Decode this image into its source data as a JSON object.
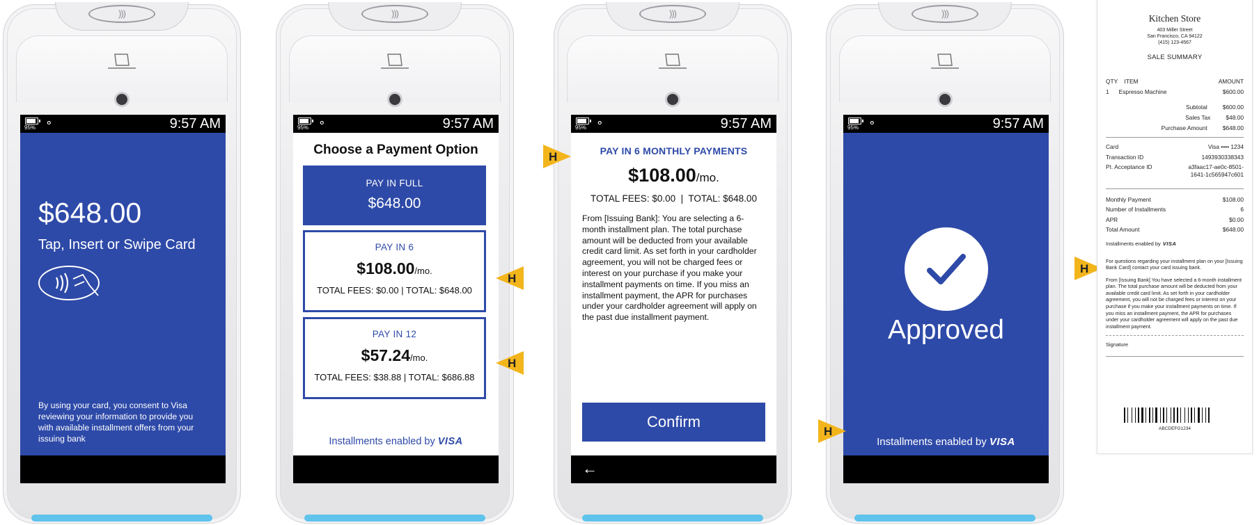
{
  "status_bar": {
    "battery_pct": "95%",
    "time": "9:57 AM"
  },
  "screen1": {
    "amount": "$648.00",
    "instruction": "Tap, Insert or Swipe Card",
    "consent": "By using your card, you consent to Visa reviewing your information to provide you with available installment offers from your issuing bank"
  },
  "screen2": {
    "title": "Choose a Payment Option",
    "options": [
      {
        "label": "PAY IN FULL",
        "amount": "$648.00"
      },
      {
        "label": "PAY IN 6",
        "amount": "$108.00",
        "unit": "/mo.",
        "fees": "TOTAL FEES: $0.00",
        "total": "TOTAL: $648.00"
      },
      {
        "label": "PAY IN 12",
        "amount": "$57.24",
        "unit": "/mo.",
        "fees": "TOTAL FEES: $38.88",
        "total": "TOTAL: $686.88"
      }
    ],
    "enabled_text": "Installments enabled by",
    "enabled_brand": "VISA"
  },
  "screen3": {
    "heading": "PAY IN 6 MONTHLY PAYMENTS",
    "amount": "$108.00",
    "unit": "/mo.",
    "fees": "TOTAL FEES: $0.00",
    "total": "TOTAL: $648.00",
    "disclosure": "From [Issuing Bank]: You are selecting a 6-month installment plan. The total purchase amount will be deducted from your available credit card limit. As set forth in your cardholder agreement, you will not be charged fees or interest on your purchase if you make your installment payments on time. If you miss an installment payment, the APR for purchases under your cardholder agreement will apply on the past due installment payment.",
    "confirm_label": "Confirm"
  },
  "screen4": {
    "status": "Approved",
    "enabled_text": "Installments enabled by",
    "enabled_brand": "VISA"
  },
  "highlight_marker": "H",
  "receipt": {
    "store": "Kitchen Store",
    "address_line1": "403 Miller Street",
    "address_line2": "San Francisco, CA 94122",
    "phone": "(415) 123-4567",
    "heading": "SALE SUMMARY",
    "col_qty": "QTY",
    "col_item": "ITEM",
    "col_amount": "AMOUNT",
    "item_qty": "1",
    "item_name": "Espresso Machine",
    "item_amount": "$600.00",
    "subtotal_label": "Subtotal",
    "subtotal": "$600.00",
    "tax_label": "Sales Tax",
    "tax": "$48.00",
    "purchase_label": "Purchase Amount",
    "purchase": "$648.00",
    "card_label": "Card",
    "card": "Visa •••• 1234",
    "txn_label": "Transaction ID",
    "txn": "1493930338343",
    "pi_label": "PI. Acceptance ID",
    "pi_line1": "a3faac17-ae0c-8501-",
    "pi_line2": "1641-1c565947c601",
    "monthly_label": "Monthly Payment",
    "monthly": "$108.00",
    "installments_label": "Number of Installments",
    "installments": "6",
    "apr_label": "APR",
    "apr": "$0.00",
    "total_label": "Total Amount",
    "total": "$648.00",
    "enabled_text": "Installments enabled by",
    "enabled_brand": "VISA",
    "questions": "For questions regarding your installment plan on your [Issuing Bank Card] contact your card issuing bank.",
    "disclosure": "From [Issuing Bank] You have selected a 6-month installment plan. The total purchase amount will be deducted from your available credit card limit. As set forth in your cardholder agreement, you will not be charged fees or interest on your purchase if you make your installment payments on time. If you miss an installment payment, the APR for purchases under your cardholder agreement will apply on the past due installment payment.",
    "signature_label": "Signature",
    "barcode_text": "ABCDEFG1234"
  },
  "colors": {
    "brand_blue": "#2e4aa8",
    "marker_yellow": "#f3b51c",
    "accent_cyan": "#5fc3ec"
  }
}
